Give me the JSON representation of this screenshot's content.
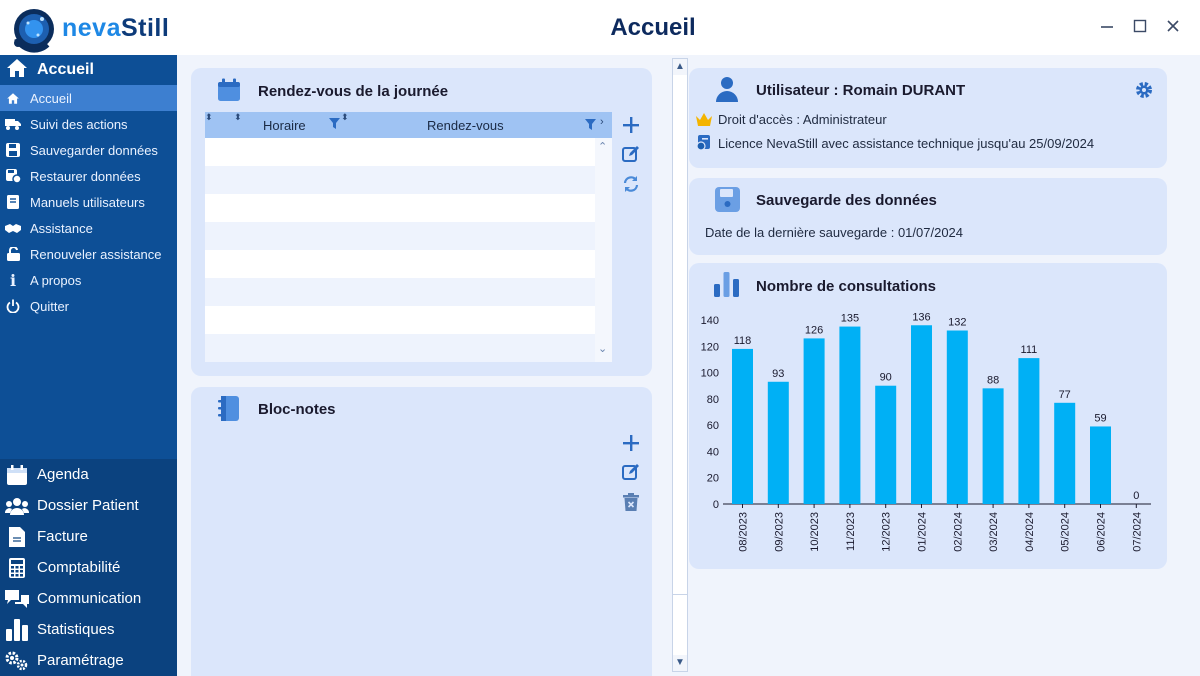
{
  "app": {
    "logo_part1": "neva",
    "logo_part2": "Still",
    "title": "Accueil",
    "window_controls": [
      "minimize-icon",
      "maximize-icon",
      "close-icon"
    ]
  },
  "sidebar": {
    "header": "Accueil",
    "items": [
      {
        "label": "Accueil",
        "icon": "home-icon",
        "active": true
      },
      {
        "label": "Suivi des actions",
        "icon": "truck-icon"
      },
      {
        "label": "Sauvegarder données",
        "icon": "save-icon"
      },
      {
        "label": "Restaurer données",
        "icon": "restore-icon"
      },
      {
        "label": "Manuels utilisateurs",
        "icon": "book-icon"
      },
      {
        "label": "Assistance",
        "icon": "handshake-icon"
      },
      {
        "label": "Renouveler assistance",
        "icon": "unlock-icon"
      },
      {
        "label": "A propos",
        "icon": "info-icon"
      },
      {
        "label": "Quitter",
        "icon": "power-icon"
      }
    ],
    "modules": [
      {
        "label": "Agenda",
        "icon": "calendar-icon"
      },
      {
        "label": "Dossier Patient",
        "icon": "users-icon"
      },
      {
        "label": "Facture",
        "icon": "invoice-icon"
      },
      {
        "label": "Comptabilité",
        "icon": "calculator-icon"
      },
      {
        "label": "Communication",
        "icon": "chat-icon"
      },
      {
        "label": "Statistiques",
        "icon": "bar-chart-icon"
      },
      {
        "label": "Paramétrage",
        "icon": "gears-icon"
      }
    ]
  },
  "appointments": {
    "title": "Rendez-vous de la journée",
    "col_time": "Horaire",
    "col_appt": "Rendez-vous",
    "rows": []
  },
  "notes": {
    "title": "Bloc-notes"
  },
  "user": {
    "title": "Utilisateur : Romain DURANT",
    "access": "Droit d'accès : Administrateur",
    "license": "Licence NevaStill avec assistance technique jusqu'au 25/09/2024"
  },
  "backup": {
    "title": "Sauvegarde des données",
    "last": "Date de la dernière sauvegarde : 01/07/2024"
  },
  "consultations": {
    "title": "Nombre de consultations"
  },
  "colors": {
    "sidebar": "#0d4f96",
    "sidebar_active": "#3d7fd0",
    "card": "#dbe6fb",
    "bar": "#00b0f5",
    "icon": "#2b6bc2"
  },
  "chart_data": {
    "type": "bar",
    "categories": [
      "08/2023",
      "09/2023",
      "10/2023",
      "11/2023",
      "12/2023",
      "01/2024",
      "02/2024",
      "03/2024",
      "04/2024",
      "05/2024",
      "06/2024",
      "07/2024"
    ],
    "values": [
      118,
      93,
      126,
      135,
      90,
      136,
      132,
      88,
      111,
      77,
      59,
      0
    ],
    "title": "",
    "xlabel": "",
    "ylabel": "",
    "ylim": [
      0,
      140
    ],
    "yticks": [
      0,
      20,
      40,
      60,
      80,
      100,
      120,
      140
    ],
    "grid": false,
    "data_labels": true
  }
}
